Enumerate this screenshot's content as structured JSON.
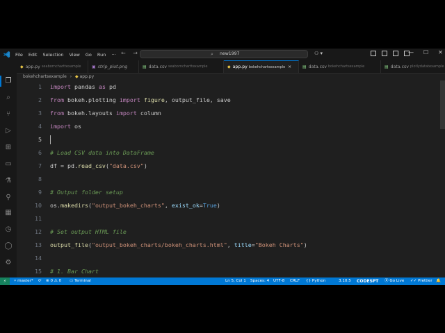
{
  "titlebar": {
    "menus": [
      "File",
      "Edit",
      "Selection",
      "View",
      "Go",
      "Run",
      "···"
    ],
    "search_text": "new1997"
  },
  "tabs": [
    {
      "icon": "py",
      "label": "app.py",
      "sub": "seaborncharttexample",
      "active": false
    },
    {
      "icon": "img",
      "label": "strip_plot.png",
      "sub": "",
      "active": false
    },
    {
      "icon": "csv",
      "label": "data.csv",
      "sub": "seaborncharttexample",
      "active": false
    },
    {
      "icon": "py",
      "label": "app.py",
      "sub": "bokehchartsexample",
      "active": true,
      "close": "×"
    },
    {
      "icon": "csv",
      "label": "data.csv",
      "sub": "bokehchartsexample",
      "active": false
    },
    {
      "icon": "csv",
      "label": "data.csv",
      "sub": "plotlydatatexample",
      "active": false
    }
  ],
  "breadcrumb": {
    "folder": "bokehchartsexample",
    "sep": "›",
    "file": "app.py"
  },
  "editor": {
    "lines": [
      {
        "n": "1"
      },
      {
        "n": "2"
      },
      {
        "n": "3"
      },
      {
        "n": "4"
      },
      {
        "n": "5"
      },
      {
        "n": "6"
      },
      {
        "n": "7"
      },
      {
        "n": "8"
      },
      {
        "n": "9"
      },
      {
        "n": "10"
      },
      {
        "n": "11"
      },
      {
        "n": "12"
      },
      {
        "n": "13"
      },
      {
        "n": "14"
      },
      {
        "n": "15"
      }
    ],
    "tokens": {
      "l1": {
        "kw1": "import",
        "t1": " pandas ",
        "kw2": "as",
        "t2": " pd"
      },
      "l2": {
        "kw1": "from",
        "t1": " bokeh.plotting ",
        "kw2": "import",
        "fn": " figure",
        "t2": ", output_file, save"
      },
      "l3": {
        "kw1": "from",
        "t1": " bokeh.layouts ",
        "kw2": "import",
        "t2": " column"
      },
      "l4": {
        "kw1": "import",
        "t1": " os"
      },
      "l6": {
        "cmt": "# Load CSV data into DataFrame"
      },
      "l7": {
        "t1": "df = pd.",
        "fn": "read_csv",
        "t2": "(",
        "str": "\"data.csv\"",
        "t3": ")"
      },
      "l9": {
        "cmt": "# Output folder setup"
      },
      "l10": {
        "t1": "os.",
        "fn": "makedirs",
        "t2": "(",
        "str": "\"output_bokeh_charts\"",
        "t3": ", ",
        "prm": "exist_ok",
        "t4": "=",
        "cnst": "True",
        "t5": ")"
      },
      "l12": {
        "cmt": "# Set output HTML file"
      },
      "l13": {
        "fn": "output_file",
        "t1": "(",
        "str": "\"output_bokeh_charts/bokeh_charts.html\"",
        "t2": ", ",
        "prm": "title",
        "t3": "=",
        "str2": "\"Bokeh Charts\"",
        "t4": ")"
      },
      "l15": {
        "cmt": "# 1. Bar Chart"
      }
    }
  },
  "statusbar": {
    "remote": "⚡",
    "branch": "master*",
    "sync": "⟳",
    "problems": "⊗ 0 ⚠ 0",
    "terminal": "Terminal",
    "position": "Ln 5, Col 1",
    "spaces": "Spaces: 4",
    "encoding": "UTF-8",
    "eol": "CRLF",
    "language": "Python",
    "version": "3.10.5",
    "brand": "CODESPT",
    "golive": "Go Live",
    "prettier": "Prettier",
    "bell": "🔔"
  },
  "colors": {
    "accent": "#0078d4",
    "editor_bg": "#1f1f1f",
    "keyword": "#c586c0",
    "string": "#ce9178",
    "comment": "#6a9955"
  }
}
